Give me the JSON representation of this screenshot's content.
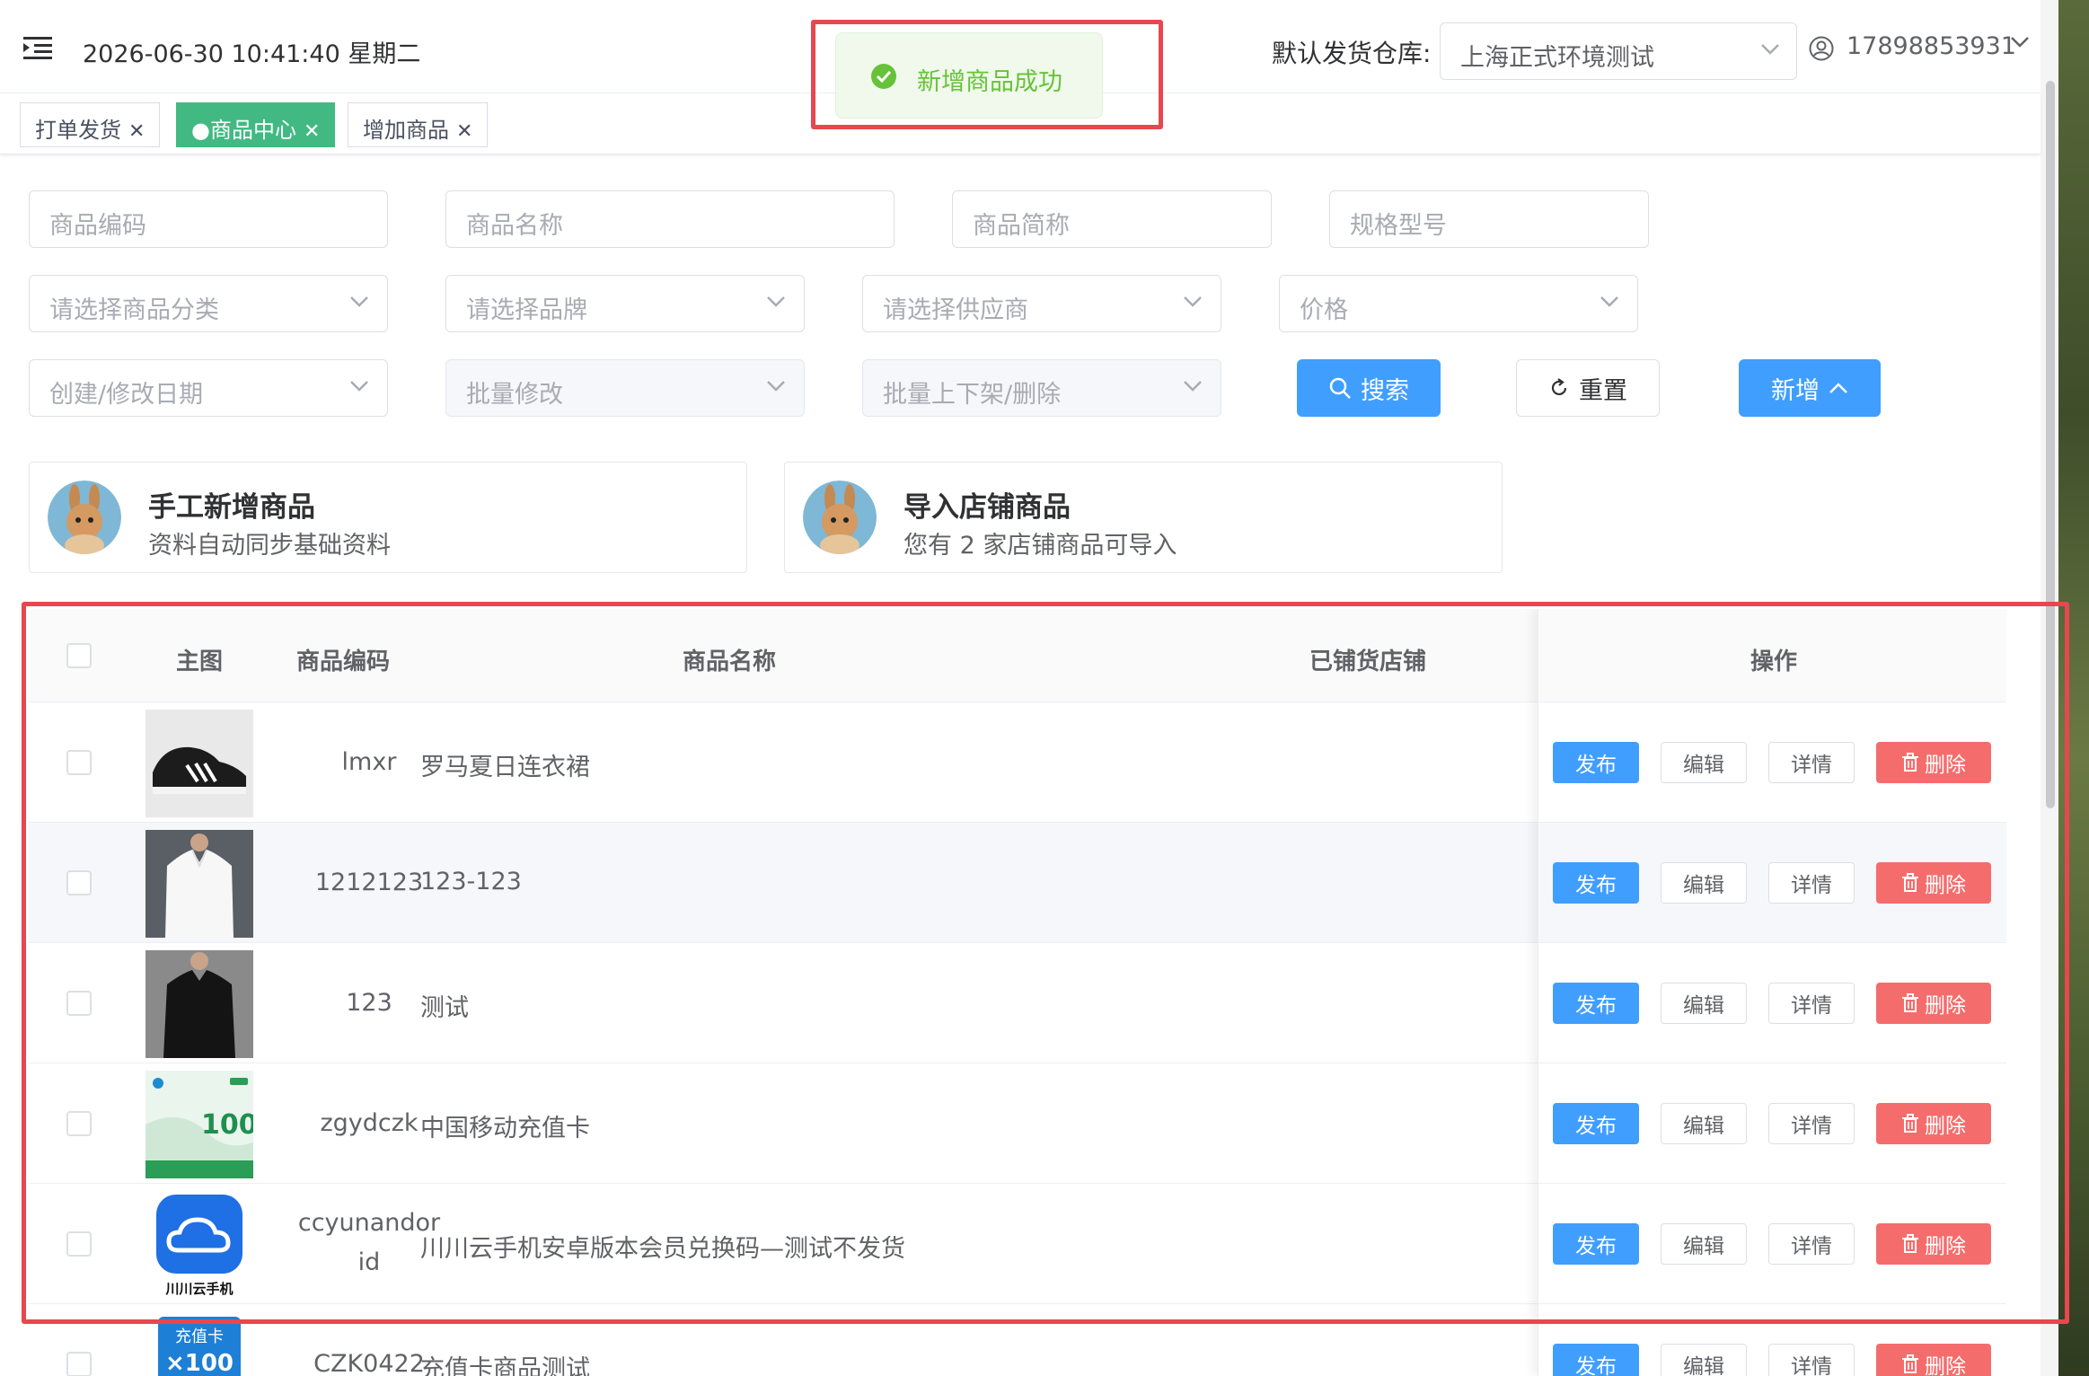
{
  "header": {
    "datetime": "2026-06-30 10:41:40 星期二",
    "warehouse_label": "默认发货仓库:",
    "warehouse_value": "上海正式环境测试",
    "user_phone": "17898853931"
  },
  "toast": {
    "message": "新增商品成功"
  },
  "tabs": [
    {
      "label": "打单发货",
      "active": false
    },
    {
      "label": "●商品中心",
      "active": true
    },
    {
      "label": "增加商品",
      "active": false
    }
  ],
  "filters": {
    "code_placeholder": "商品编码",
    "name_placeholder": "商品名称",
    "short_placeholder": "商品简称",
    "spec_placeholder": "规格型号",
    "category_placeholder": "请选择商品分类",
    "brand_placeholder": "请选择品牌",
    "supplier_placeholder": "请选择供应商",
    "price_placeholder": "价格",
    "date_placeholder": "创建/修改日期",
    "batch_edit": "批量修改",
    "batch_shelf": "批量上下架/删除",
    "search_button": "搜索",
    "reset_button": "重置",
    "add_button": "新增"
  },
  "quick_cards": [
    {
      "title": "手工新增商品",
      "subtitle": "资料自动同步基础资料"
    },
    {
      "title": "导入店铺商品",
      "subtitle": "您有 2 家店铺商品可导入"
    }
  ],
  "table": {
    "headers": {
      "image": "主图",
      "code": "商品编码",
      "name": "商品名称",
      "shops": "已铺货店铺",
      "actions": "操作"
    },
    "action_labels": {
      "publish": "发布",
      "edit": "编辑",
      "detail": "详情",
      "delete": "删除"
    },
    "rows": [
      {
        "code": "lmxr",
        "name": "罗马夏日连衣裙",
        "image": "sneaker"
      },
      {
        "code": "1212123",
        "name": "123-123",
        "image": "white-shirt"
      },
      {
        "code": "123",
        "name": "测试",
        "image": "black-shirt"
      },
      {
        "code": "zgydczk",
        "name": "中国移动充值卡",
        "image": "mobile-card"
      },
      {
        "code": "ccyunandor\nid",
        "name": "川川云手机安卓版本会员兑换码—测试不发货",
        "image": "cloud-phone-logo"
      },
      {
        "code": "CZK0422",
        "name": "充值卡商品测试",
        "image": "recharge-card"
      }
    ],
    "image_texts": {
      "mobile_card_value": "100",
      "cloud_logo_text": "川川云手机",
      "recharge_card_text": "充值卡",
      "recharge_card_value": "×100"
    }
  },
  "colors": {
    "primary": "#409eff",
    "danger": "#f56c6c",
    "success": "#67c23a",
    "tag_active": "#42b983",
    "highlight": "#e8474f"
  }
}
